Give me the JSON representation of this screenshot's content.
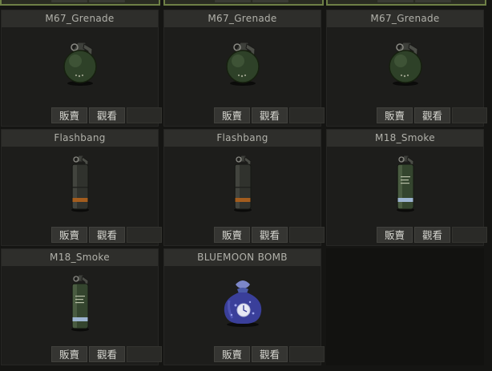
{
  "inventory": {
    "buttons": {
      "sell": "販賣",
      "view": "觀看"
    },
    "items": [
      {
        "name": "M67_Grenade",
        "icon": "frag-grenade-icon"
      },
      {
        "name": "M67_Grenade",
        "icon": "frag-grenade-icon"
      },
      {
        "name": "M67_Grenade",
        "icon": "frag-grenade-icon"
      },
      {
        "name": "Flashbang",
        "icon": "flashbang-grenade-icon"
      },
      {
        "name": "Flashbang",
        "icon": "flashbang-grenade-icon"
      },
      {
        "name": "M18_Smoke",
        "icon": "smoke-grenade-icon"
      },
      {
        "name": "M18_Smoke",
        "icon": "smoke-grenade-icon"
      },
      {
        "name": "BLUEMOON BOMB",
        "icon": "bluemoon-bomb-icon"
      }
    ]
  }
}
